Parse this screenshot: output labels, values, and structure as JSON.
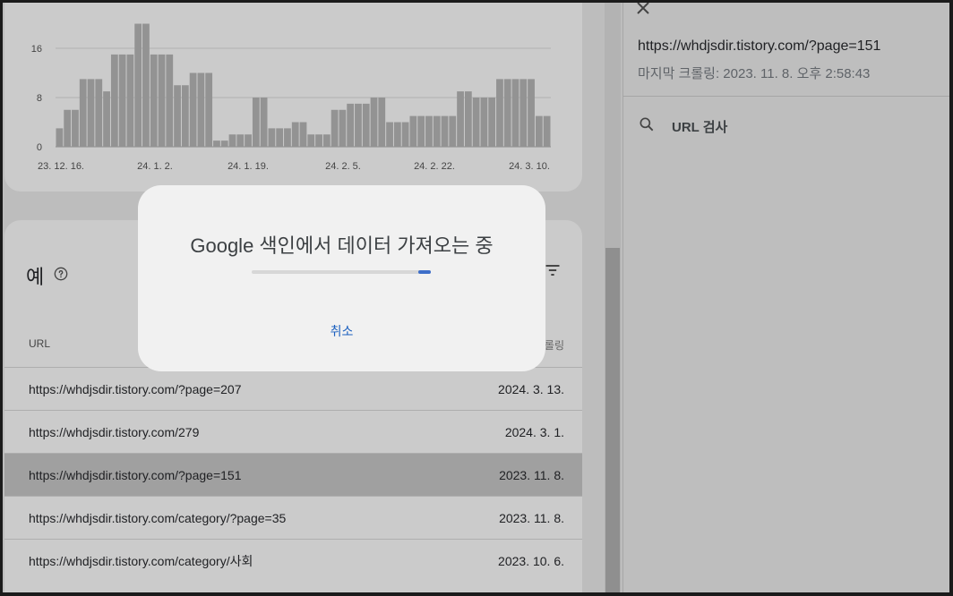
{
  "chart_data": {
    "type": "bar",
    "ylim": [
      0,
      16
    ],
    "yticks": [
      0,
      8,
      16
    ],
    "ytick_labels": [
      "0",
      "8",
      "16"
    ],
    "xtick_labels": [
      "23. 12. 16.",
      "24. 1. 2.",
      "24. 1. 19.",
      "24. 2. 5.",
      "24. 2. 22.",
      "24. 3. 10."
    ],
    "values": [
      3,
      6,
      6,
      11,
      11,
      11,
      9,
      15,
      15,
      15,
      20,
      20,
      15,
      15,
      15,
      10,
      10,
      12,
      12,
      12,
      1,
      1,
      2,
      2,
      2,
      8,
      8,
      3,
      3,
      3,
      4,
      4,
      2,
      2,
      2,
      6,
      6,
      7,
      7,
      7,
      8,
      8,
      4,
      4,
      4,
      5,
      5,
      5,
      5,
      5,
      5,
      9,
      9,
      8,
      8,
      8,
      11,
      11,
      11,
      11,
      11,
      5,
      5
    ]
  },
  "table": {
    "title": "예",
    "col_url": "URL",
    "col_crawl": "최종 크롤링",
    "rows": [
      {
        "url": "https://whdjsdir.tistory.com/?page=207",
        "date": "2024. 3. 13."
      },
      {
        "url": "https://whdjsdir.tistory.com/279",
        "date": "2024. 3. 1."
      },
      {
        "url": "https://whdjsdir.tistory.com/?page=151",
        "date": "2023. 11. 8."
      },
      {
        "url": "https://whdjsdir.tistory.com/category/?page=35",
        "date": "2023. 11. 8."
      },
      {
        "url": "https://whdjsdir.tistory.com/category/사회",
        "date": "2023. 10. 6."
      }
    ]
  },
  "dialog": {
    "title": "Google 색인에서 데이터 가져오는 중",
    "cancel": "취소",
    "progress": 0.07
  },
  "panel": {
    "url": "https://whdjsdir.tistory.com/?page=151",
    "last_crawl": "마지막 크롤링: 2023. 11. 8. 오후 2:58:43",
    "inspect_label": "URL 검사"
  },
  "colors": {
    "bar": "#939393",
    "accent": "#3d6ec9"
  },
  "icons": [
    "close-icon",
    "search-icon",
    "help-icon",
    "filter-icon",
    "arrow-down-icon"
  ]
}
